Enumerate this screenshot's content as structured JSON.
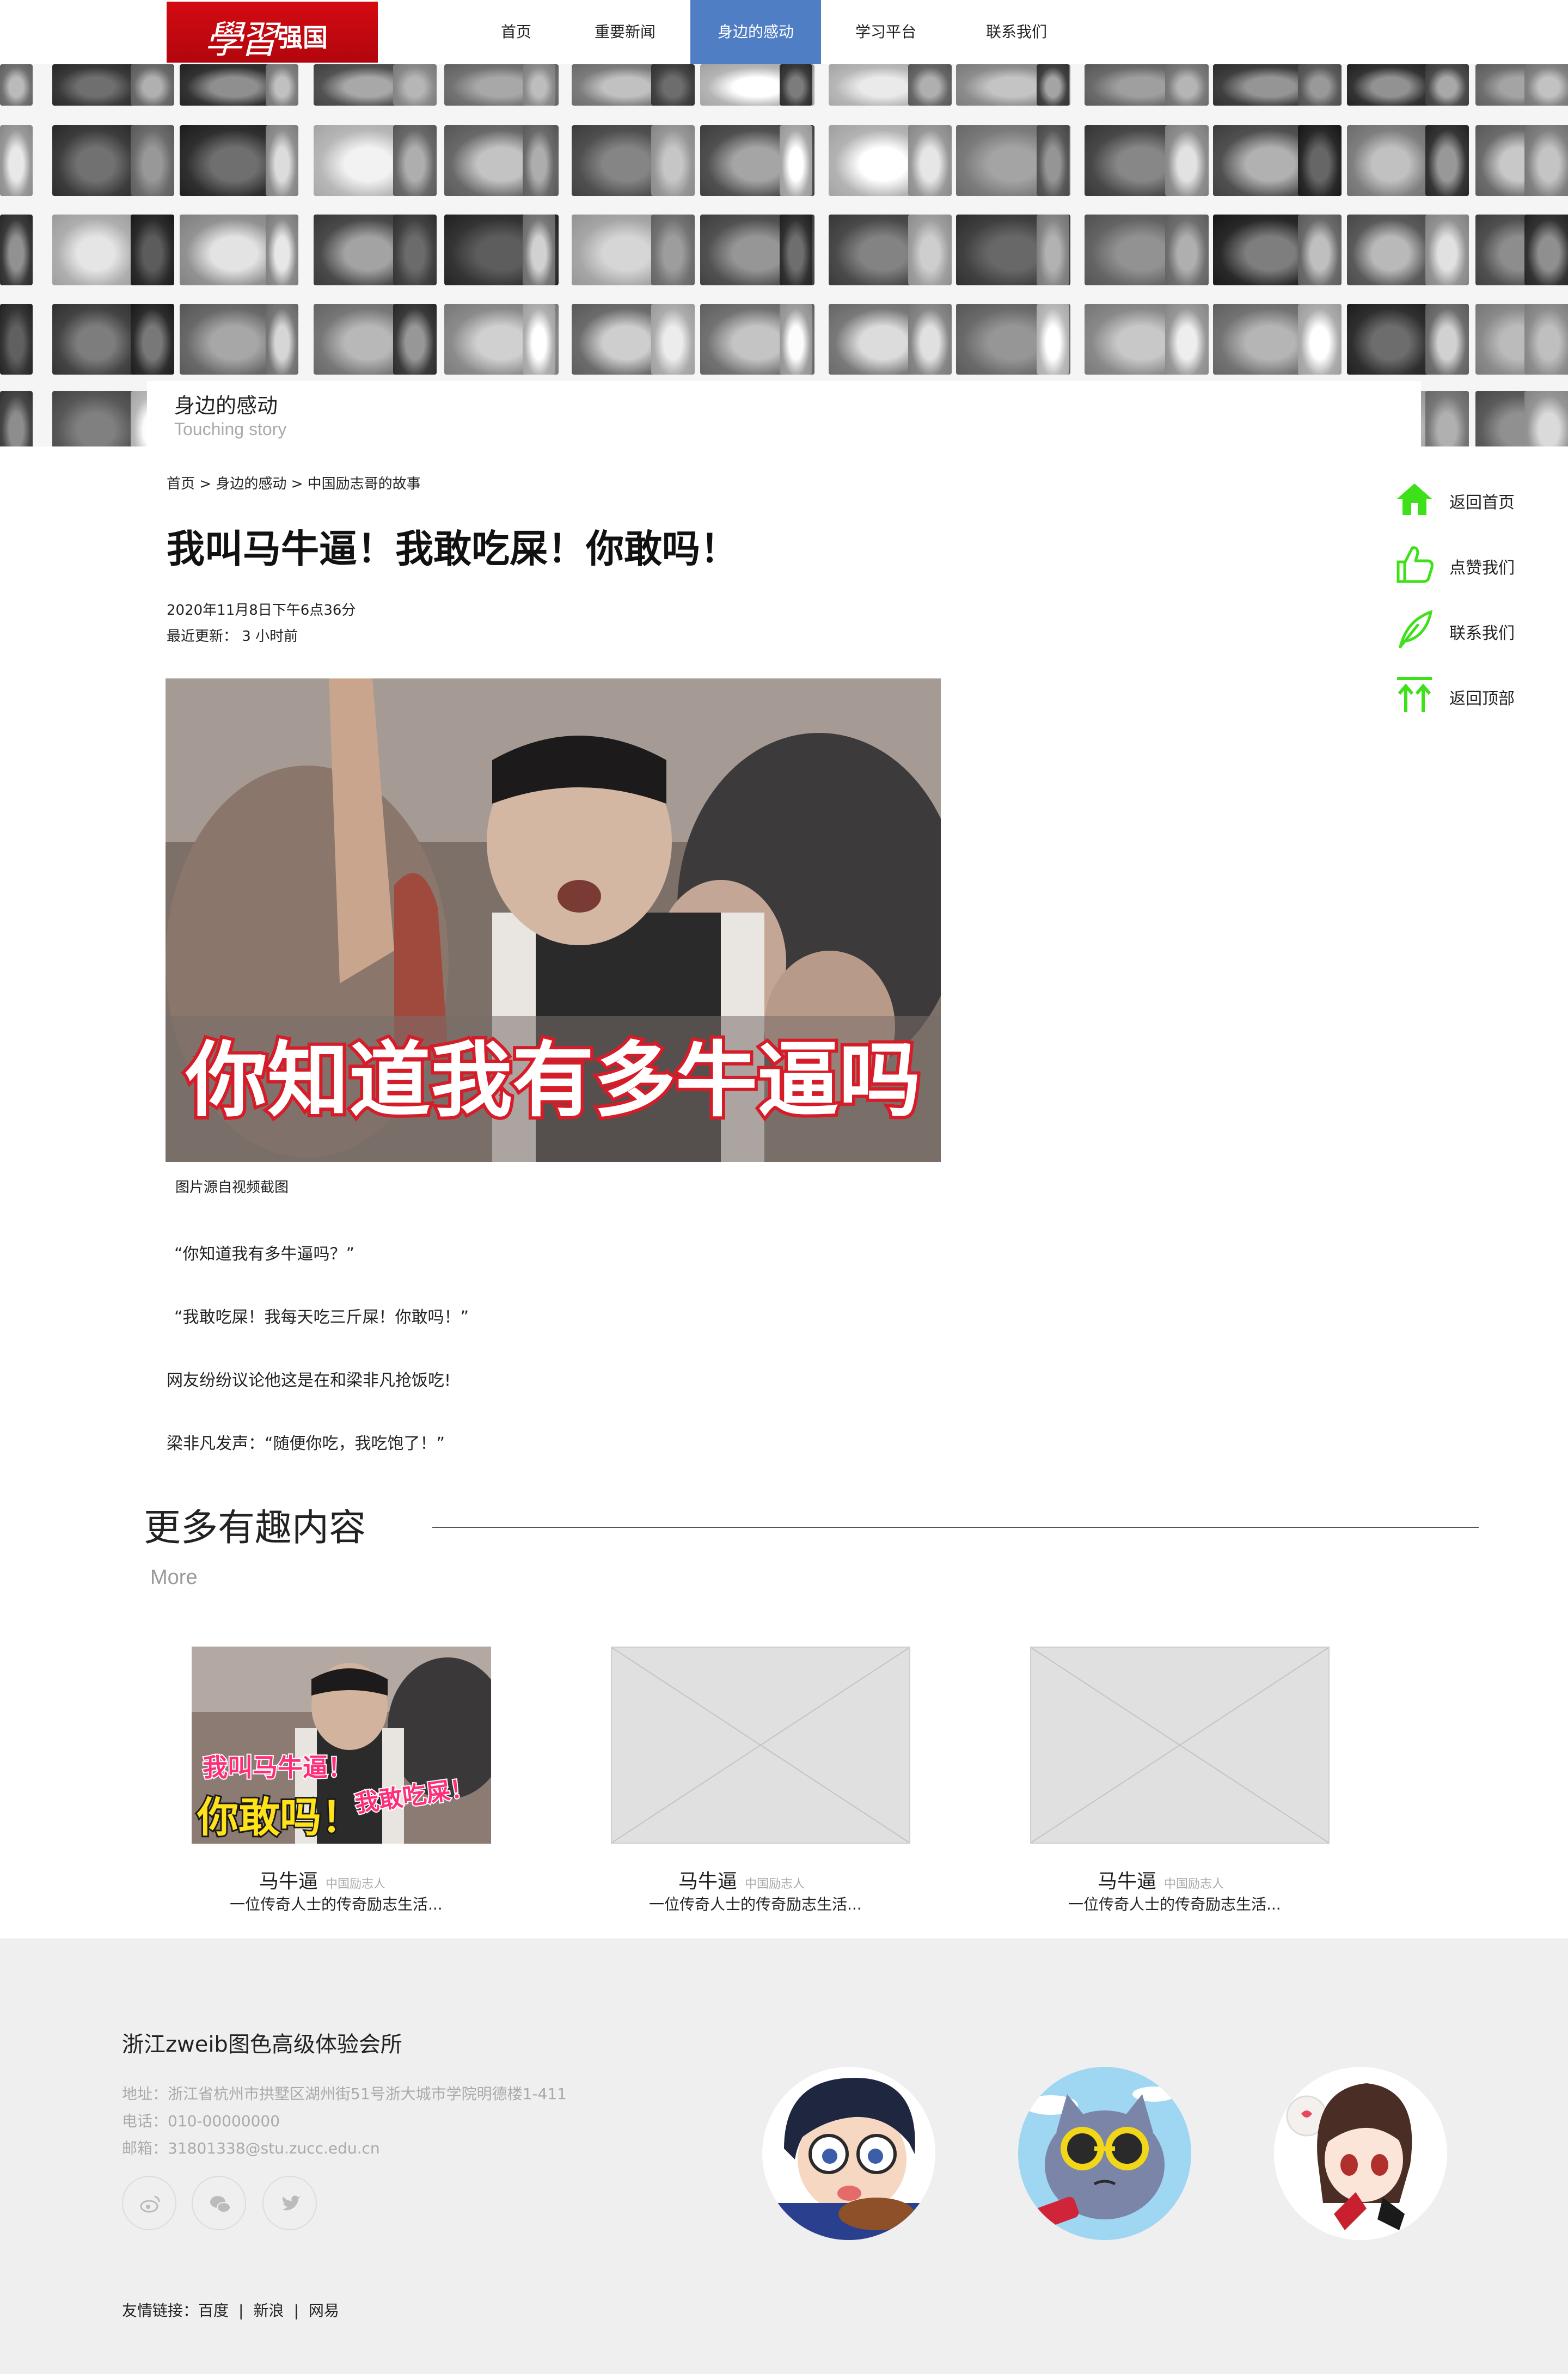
{
  "nav": {
    "logo_text_1": "學習",
    "logo_text_2": "强国",
    "items": [
      "首页",
      "重要新闻",
      "身边的感动",
      "学习平台",
      "联系我们"
    ],
    "active": "身边的感动"
  },
  "banner": {
    "title": "身边的感动",
    "subtitle": "Touching story"
  },
  "breadcrumb": "首页 > 身边的感动 > 中国励志哥的故事",
  "article": {
    "title": "我叫马牛逼！我敢吃屎！你敢吗！",
    "date": "2020年11月8日下午6点36分",
    "updated": "最近更新： 3 小时前",
    "image_overlay": "你知道我有多牛逼吗",
    "image_caption": "图片源自视频截图",
    "paragraphs": [
      "“你知道我有多牛逼吗？”",
      "“我敢吃屎！我每天吃三斤屎！你敢吗！”",
      "网友纷纷议论他这是在和梁非凡抢饭吃!",
      "梁非凡发声：“随便你吃，我吃饱了！”"
    ]
  },
  "side_nav": [
    {
      "label": "返回首页",
      "icon": "home-icon"
    },
    {
      "label": "点赞我们",
      "icon": "thumbs-up-icon"
    },
    {
      "label": "联系我们",
      "icon": "feather-icon"
    },
    {
      "label": "返回顶部",
      "icon": "arrow-up-icon"
    }
  ],
  "more": {
    "title": "更多有趣内容",
    "subtitle": "More",
    "cards": [
      {
        "name": "马牛逼",
        "tag": "中国励志人",
        "desc": "一位传奇人士的传奇励志生活...",
        "overlay_1": "我叫马牛逼！",
        "overlay_2": "我敢吃屎！",
        "overlay_3": "你敢吗！"
      },
      {
        "name": "马牛逼",
        "tag": "中国励志人",
        "desc": "一位传奇人士的传奇励志生活..."
      },
      {
        "name": "马牛逼",
        "tag": "中国励志人",
        "desc": "一位传奇人士的传奇励志生活..."
      }
    ]
  },
  "footer": {
    "org": "浙江zweib图色高级体验会所",
    "address": "地址：浙江省杭州市拱墅区湖州街51号浙大城市学院明德楼1-411",
    "phone": "电话：010-00000000",
    "email": "邮箱：31801338@stu.zucc.edu.cn",
    "social_icons": [
      "weibo-icon",
      "wechat-icon",
      "twitter-icon"
    ],
    "links_label": "友情链接：",
    "links": [
      "百度",
      "新浪",
      "网易"
    ]
  },
  "colors": {
    "nav_active": "#4f7ec4",
    "side_icon": "#3ee01a",
    "logo_red": "#d40a12",
    "footer_bg": "#efefef"
  }
}
